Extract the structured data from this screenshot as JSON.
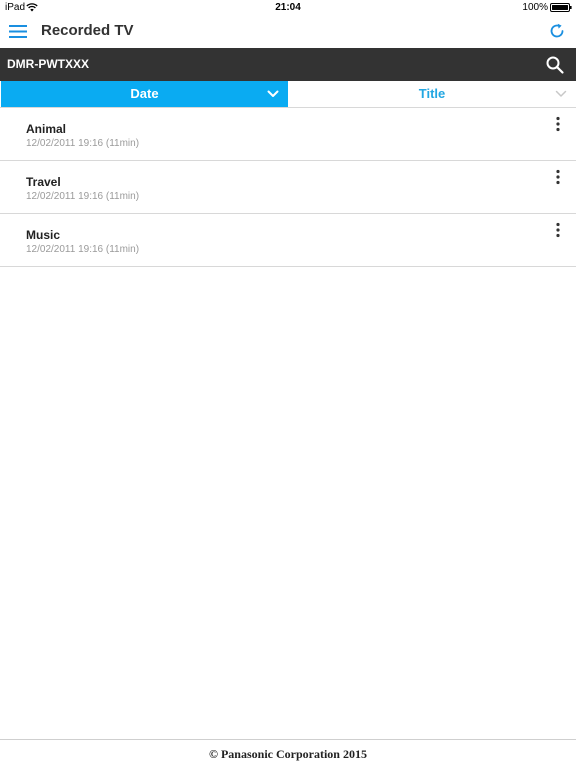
{
  "status_bar": {
    "carrier": "iPad",
    "time": "21:04",
    "battery": "100%"
  },
  "nav": {
    "title": "Recorded TV",
    "menu_icon": "hamburger-menu-icon",
    "refresh_icon": "refresh-icon"
  },
  "device": {
    "name": "DMR-PWTXXX",
    "search_icon": "search-icon"
  },
  "sort_tabs": [
    {
      "label": "Date",
      "selected": true
    },
    {
      "label": "Title",
      "selected": false
    }
  ],
  "recordings": [
    {
      "title": "Animal",
      "datetime": "12/02/2011 19:16 (11min)"
    },
    {
      "title": "Travel",
      "datetime": "12/02/2011 19:16 (11min)"
    },
    {
      "title": "Music",
      "datetime": "12/02/2011 19:16 (11min)"
    }
  ],
  "footer": {
    "text": "© Panasonic Corporation 2015"
  },
  "colors": {
    "accent": "#0aabf2",
    "tab_text": "#23a7e2",
    "device_bar": "#333333"
  }
}
